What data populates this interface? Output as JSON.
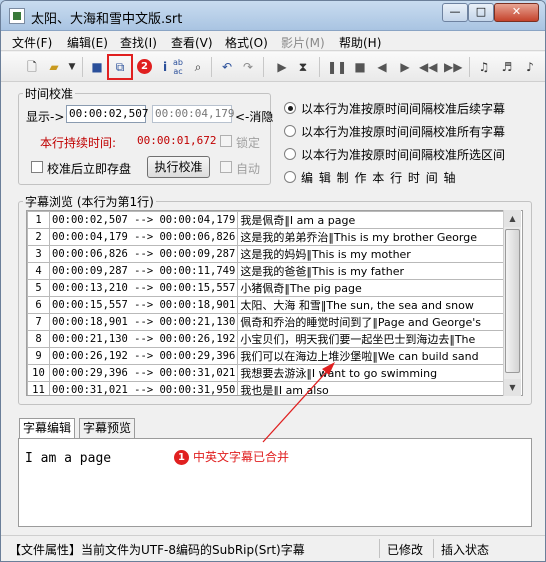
{
  "window": {
    "title": "太阳、大海和雪中文版.srt"
  },
  "menu": [
    "文件(F)",
    "编辑(E)",
    "查找(I)",
    "查看(V)",
    "格式(O)",
    "影片(M)",
    "帮助(H)"
  ],
  "toolbar": {
    "annotation_badge": "2",
    "icons": [
      "new-file-icon",
      "open-folder-icon",
      "dropdown-arrow-icon",
      "save-icon",
      "merge-subtitle-icon",
      "info-icon",
      "spell-check-icon",
      "zoom-icon",
      "undo-icon",
      "redo-icon",
      "play-icon",
      "sync-icon",
      "pause-icon",
      "stop-icon",
      "prev-icon",
      "next-icon",
      "rewind-icon",
      "fast-forward-icon",
      "music-note-icon",
      "music-edit-icon"
    ]
  },
  "time_calibration": {
    "legend": "时间校准",
    "display_label": "显示->",
    "display_value": "00:00:02,507",
    "end_value": "00:00:04,179",
    "clear_label": "<-消隐",
    "duration_label": "本行持续时间:",
    "duration_value": "00:00:01,672",
    "lock_label": "锁定",
    "save_after_label": "校准后立即存盘",
    "execute_label": "执行校准",
    "auto_label": "自动"
  },
  "calibration_options": [
    {
      "label": "以本行为准按原时间间隔校准后续字幕",
      "selected": true
    },
    {
      "label": "以本行为准按原时间间隔校准所有字幕",
      "selected": false
    },
    {
      "label": "以本行为准按原时间间隔校准所选区间",
      "selected": false
    },
    {
      "label": "编 辑 制 作 本 行 时 间 轴",
      "selected": false
    }
  ],
  "subtitle_browse": {
    "legend": "字幕浏览 (本行为第1行)",
    "rows": [
      {
        "no": "1",
        "time": "00:00:02,507 --> 00:00:04,179",
        "text": "我是佩奇‖I am a page"
      },
      {
        "no": "2",
        "time": "00:00:04,179 --> 00:00:06,826",
        "text": "这是我的弟弟乔治‖This is my brother George"
      },
      {
        "no": "3",
        "time": "00:00:06,826 --> 00:00:09,287",
        "text": "这是我的妈妈‖This is my mother"
      },
      {
        "no": "4",
        "time": "00:00:09,287 --> 00:00:11,749",
        "text": "这是我的爸爸‖This is my father"
      },
      {
        "no": "5",
        "time": "00:00:13,210 --> 00:00:15,557",
        "text": "小猪佩奇‖The pig page"
      },
      {
        "no": "6",
        "time": "00:00:15,557 --> 00:00:18,901",
        "text": "太阳、大海 和雪‖The sun, the sea and snow"
      },
      {
        "no": "7",
        "time": "00:00:18,901 --> 00:00:21,130",
        "text": "佩奇和乔治的睡觉时间到了‖Page and George's"
      },
      {
        "no": "8",
        "time": "00:00:21,130 --> 00:00:26,192",
        "text": "小宝贝们，明天我们要一起坐巴士到海边去‖The"
      },
      {
        "no": "9",
        "time": "00:00:26,192 --> 00:00:29,396",
        "text": "我们可以在海边上堆沙堡啦‖We can build sand"
      },
      {
        "no": "10",
        "time": "00:00:29,396 --> 00:00:31,021",
        "text": "我想要去游泳‖I want to go swimming"
      },
      {
        "no": "11",
        "time": "00:00:31,021 --> 00:00:31,950",
        "text": "我也是‖I am also"
      }
    ]
  },
  "editor": {
    "tabs": [
      "字幕编辑",
      "字幕预览"
    ],
    "text": "I am a page",
    "annotation_badge": "1",
    "annotation_text": "中英文字幕已合并"
  },
  "status": {
    "file_info": "【文件属性】当前文件为UTF-8编码的SubRip(Srt)字幕",
    "modified": "已修改",
    "insert_mode": "插入状态"
  },
  "colors": {
    "annotation_red": "#e02020",
    "duration_red": "#c00000"
  }
}
